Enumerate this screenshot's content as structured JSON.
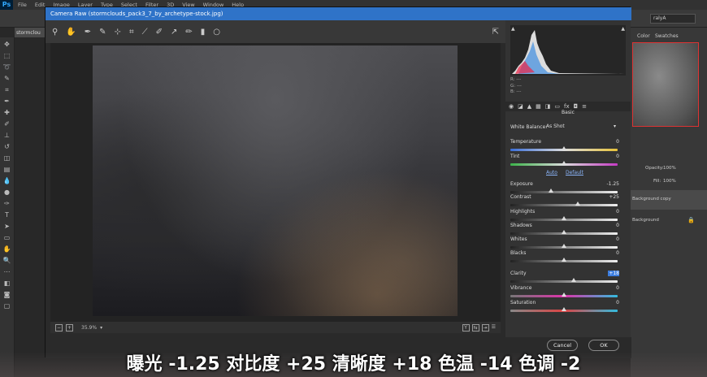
{
  "app": {
    "menu": [
      "File",
      "Edit",
      "Image",
      "Layer",
      "Type",
      "Select",
      "Filter",
      "3D",
      "View",
      "Window",
      "Help"
    ],
    "doc_tab": "stormclou",
    "layer_field": "ralyA"
  },
  "dialog": {
    "title": "Camera Raw (stormclouds_pack3_7_by_archetype-stock.jpg)",
    "zoom": "35.9%",
    "cancel": "Cancel",
    "ok": "OK"
  },
  "right_panels": {
    "tab_color": "Color",
    "tab_swatches": "Swatches",
    "opacity_label": "Opacity:",
    "opacity_value": "100%",
    "fill_label": "Fill:",
    "fill_value": "100%",
    "layer1": "Background copy",
    "layer2": "Background"
  },
  "rgb": {
    "r": "R:  ---",
    "g": "G:  ---",
    "b": "B:  ---"
  },
  "basic": {
    "section": "Basic",
    "wb_label": "White Balance:",
    "wb_value": "As Shot",
    "auto": "Auto",
    "default": "Default",
    "rows": [
      {
        "label": "Temperature",
        "value": "0",
        "pos": 0.5
      },
      {
        "label": "Tint",
        "value": "0",
        "pos": 0.5
      },
      {
        "label": "Exposure",
        "value": "-1.25",
        "pos": 0.38
      },
      {
        "label": "Contrast",
        "value": "+25",
        "pos": 0.63
      },
      {
        "label": "Highlights",
        "value": "0",
        "pos": 0.5
      },
      {
        "label": "Shadows",
        "value": "0",
        "pos": 0.5
      },
      {
        "label": "Whites",
        "value": "0",
        "pos": 0.5
      },
      {
        "label": "Blacks",
        "value": "0",
        "pos": 0.5
      },
      {
        "label": "Clarity",
        "value": "+18",
        "pos": 0.59
      },
      {
        "label": "Vibrance",
        "value": "0",
        "pos": 0.5
      },
      {
        "label": "Saturation",
        "value": "0",
        "pos": 0.5
      }
    ]
  },
  "subtitle": "曝光 -1.25 对比度 +25 清晰度 +18 色温 -14 色调 -2",
  "colors": {
    "accent": "#2f73c8",
    "clarity_highlight": "#3d7ee0"
  }
}
